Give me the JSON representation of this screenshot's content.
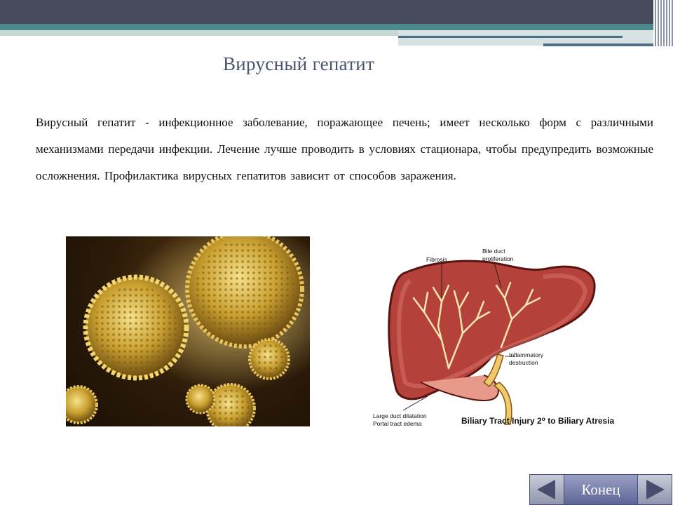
{
  "slide": {
    "title": "Вирусный гепатит",
    "body": "Вирусный гепатит - инфекционное заболевание, поражающее печень; имеет несколько форм с различными механизмами передачи инфекции. Лечение лучше проводить в условиях стационара, чтобы предупредить возможные осложнения. Профилактика вирусных гепатитов зависит от способов заражения."
  },
  "diagram": {
    "labels": {
      "fibrosis": "Fibrosis",
      "bile_duct_1": "Bile duct",
      "bile_duct_2": "proliferation",
      "inflammatory_1": "Inflammatory",
      "inflammatory_2": "destruction",
      "large_duct": "Large duct dilatation",
      "portal_tract": "Portal tract edema",
      "caption": "Biliary Tract Injury 2⁰ to Biliary Atresia"
    }
  },
  "nav": {
    "end_label": "Конец",
    "prev_icon": "triangle-left-icon",
    "next_icon": "triangle-right-icon"
  },
  "colors": {
    "header_dark": "#484b5c",
    "header_teal": "#4c8a8c",
    "title": "#4a5370",
    "nav": "#5d6596"
  }
}
